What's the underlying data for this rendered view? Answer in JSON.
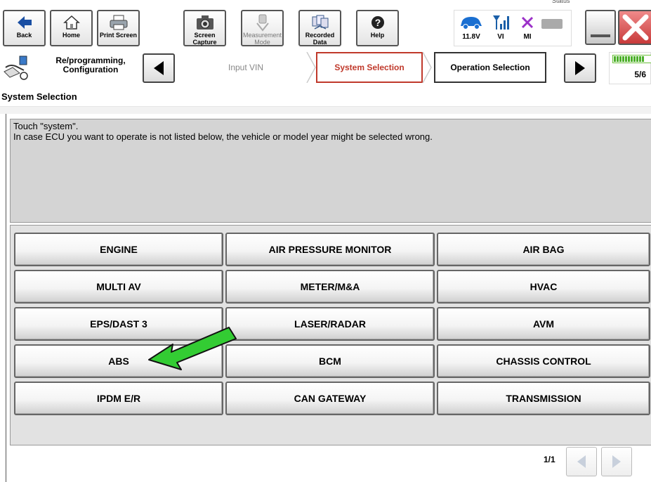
{
  "toolbar": {
    "buttons": [
      {
        "label": "Back",
        "icon": "back-arrow-icon"
      },
      {
        "label": "Home",
        "icon": "home-icon"
      },
      {
        "label": "Print Screen",
        "icon": "printer-icon"
      },
      {
        "label": "Screen\nCapture",
        "icon": "camera-icon"
      },
      {
        "label": "Measurement\nMode",
        "icon": "measurement-icon"
      },
      {
        "label": "Recorded\nData",
        "icon": "recorded-data-icon"
      },
      {
        "label": "Help",
        "icon": "help-icon"
      }
    ],
    "status": {
      "voltage": "11.8V",
      "vi_label": "VI",
      "mi_label": "MI",
      "header_fragment": "Status"
    }
  },
  "nav": {
    "app_label": "Re/programming,\nConfiguration",
    "steps": [
      {
        "label": "Input VIN",
        "state": "done"
      },
      {
        "label": "System Selection",
        "state": "current"
      },
      {
        "label": "Operation Selection",
        "state": "next"
      }
    ],
    "progress": {
      "text": "5/6",
      "fraction": 0.8333
    }
  },
  "screen": {
    "title": "System Selection",
    "instruction_line1": "Touch \"system\".",
    "instruction_line2": "In case ECU you want to operate is not listed below, the vehicle or model year might be selected wrong."
  },
  "systems": [
    [
      "ENGINE",
      "AIR PRESSURE MONITOR",
      "AIR BAG"
    ],
    [
      "MULTI AV",
      "METER/M&A",
      "HVAC"
    ],
    [
      "EPS/DAST 3",
      "LASER/RADAR",
      "AVM"
    ],
    [
      "ABS",
      "BCM",
      "CHASSIS CONTROL"
    ],
    [
      "IPDM E/R",
      "CAN GATEWAY",
      "TRANSMISSION"
    ]
  ],
  "pagination": {
    "text": "1/1"
  },
  "colors": {
    "current_step": "#c0392b",
    "close_button": "#d64545",
    "annotation_arrow": "#33cc33",
    "progress_green": "#4caf2a"
  }
}
